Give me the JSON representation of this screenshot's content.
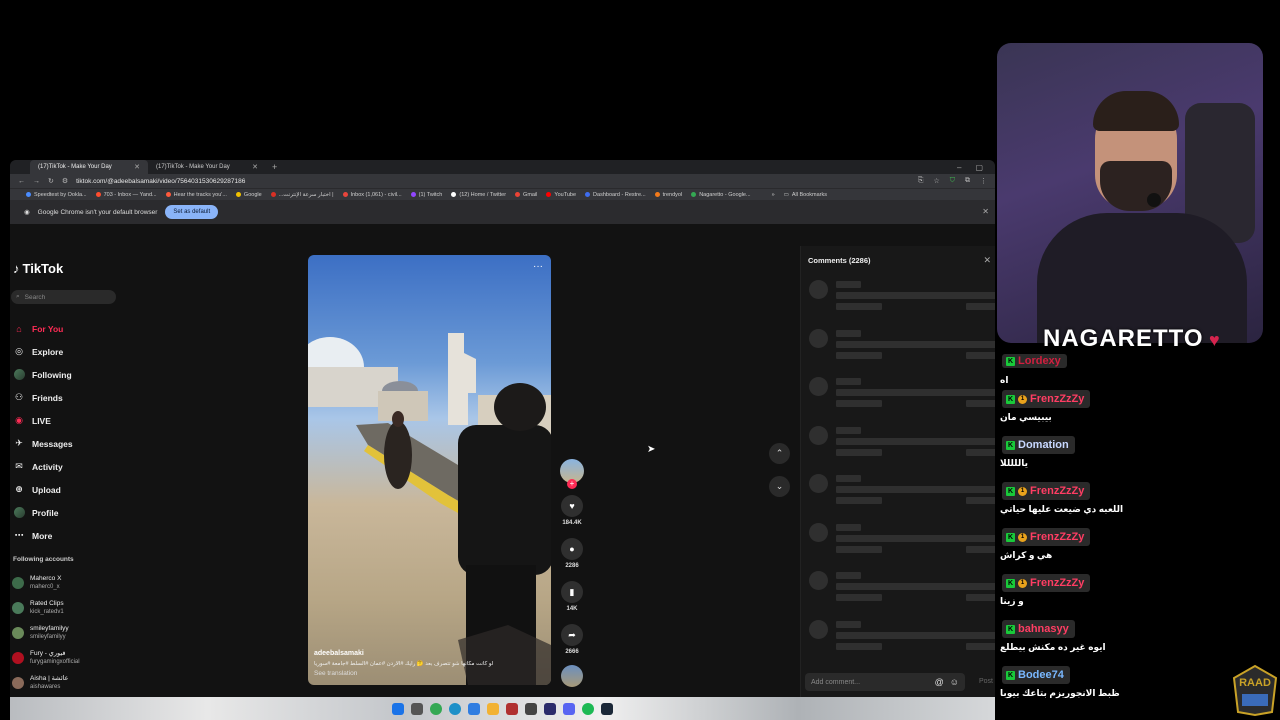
{
  "browser": {
    "tabs": [
      {
        "label": "(17)TikTok - Make Your Day"
      },
      {
        "label": "(17)TikTok - Make Your Day"
      }
    ],
    "url": "tiktok.com/@adeebalsamaki/video/7564031530629287186",
    "bookmarks": [
      {
        "label": "Speedtest by Ookla...",
        "color": "#4a8cff"
      },
      {
        "label": "703 - Inbox — Yand...",
        "color": "#ff4d2e"
      },
      {
        "label": "Hear the tracks you'...",
        "color": "#ff5a3c"
      },
      {
        "label": "Google",
        "color": "#f2c200"
      },
      {
        "label": "...اختبار سرعة الإنترنت |",
        "color": "#d93025"
      },
      {
        "label": "Inbox (1,061) - civil...",
        "color": "#e8453c"
      },
      {
        "label": "(1) Twitch",
        "color": "#9146ff"
      },
      {
        "label": "(12) Home / Twitter",
        "color": "#ffffff"
      },
      {
        "label": "Gmail",
        "color": "#ea4335"
      },
      {
        "label": "YouTube",
        "color": "#ff0000"
      },
      {
        "label": "Dashboard - Restre...",
        "color": "#3e6df0"
      },
      {
        "label": "trendyol",
        "color": "#f27a1a"
      },
      {
        "label": "Nagaretto - Google...",
        "color": "#34a853"
      }
    ],
    "all_bookmarks": "All Bookmarks",
    "infobar_text": "Google Chrome isn't your default browser",
    "infobar_button": "Set as default"
  },
  "tiktok": {
    "logo": "TikTok",
    "search_placeholder": "Search",
    "nav": [
      {
        "label": "For You",
        "icon": "home-icon",
        "active": true
      },
      {
        "label": "Explore",
        "icon": "compass-icon"
      },
      {
        "label": "Following",
        "icon": "following-icon"
      },
      {
        "label": "Friends",
        "icon": "friends-icon"
      },
      {
        "label": "LIVE",
        "icon": "live-icon"
      },
      {
        "label": "Messages",
        "icon": "messages-icon"
      },
      {
        "label": "Activity",
        "icon": "activity-icon"
      },
      {
        "label": "Upload",
        "icon": "upload-icon"
      },
      {
        "label": "Profile",
        "icon": "profile-icon"
      },
      {
        "label": "More",
        "icon": "more-icon"
      }
    ],
    "following_title": "Following accounts",
    "following": [
      {
        "name": "Maherco X",
        "handle": "maherc0_x",
        "color": "#3d6b4a"
      },
      {
        "name": "Rated Clips",
        "handle": "kick_ratedv1",
        "color": "#4a7a5a"
      },
      {
        "name": "smileyfamilyy",
        "handle": "smileyfamilyy",
        "color": "#6a8a5a"
      },
      {
        "name": "Fury - فيوري",
        "handle": "furygamingxofficial",
        "color": "#b01020"
      },
      {
        "name": "Aisha | عائشة",
        "handle": "aishawares",
        "color": "#8a6a5a"
      }
    ],
    "video": {
      "author": "adeebalsamaki",
      "description": "لو كانت مكانها شو تتصرف بعد 🤔 رايك #الاردن #عمان #السلط #جامعة #سوريا",
      "see_translation": "See translation"
    },
    "actions": {
      "likes": "184.4K",
      "comments": "2286",
      "saves": "14K",
      "shares": "2666"
    },
    "comments_panel": {
      "title": "Comments (2286)",
      "input_placeholder": "Add comment...",
      "post_label": "Post",
      "skeleton_rows": 8
    }
  },
  "overlay": {
    "brand": "NAGARETTO",
    "chat": [
      {
        "user": "Lordexy",
        "text": "اه",
        "user_color": "#d11f3f",
        "coin": false
      },
      {
        "user": "FrenzZzZy",
        "text": "بيبيسي مان",
        "user_color": "#ff3d63",
        "coin": true
      },
      {
        "user": "Domation",
        "text": "يالللللا",
        "user_color": "#c8d8ff",
        "coin": false
      },
      {
        "user": "FrenzZzZy",
        "text": "اللعبه دي ضيعت عليها حياتي",
        "user_color": "#ff3d63",
        "coin": true
      },
      {
        "user": "FrenzZzZy",
        "text": "هي و كراش",
        "user_color": "#ff3d63",
        "coin": true
      },
      {
        "user": "FrenzZzZy",
        "text": "و زينا",
        "user_color": "#ff3d63",
        "coin": true
      },
      {
        "user": "bahnasyy",
        "text": "ايوه غير ده مكنش بيطلع",
        "user_color": "#ff3d63",
        "coin": false
      },
      {
        "user": "Bodee74",
        "text": "ظبط الانجوريزم بتاعك بيوبا",
        "user_color": "#7ab8ff",
        "coin": false
      }
    ]
  }
}
